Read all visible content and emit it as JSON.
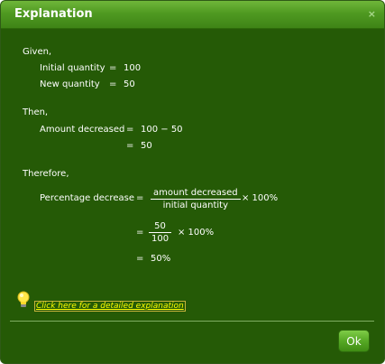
{
  "dialog": {
    "title": "Explanation",
    "close_symbol": "×",
    "ok_label": "Ok",
    "link_label": "Click here for a detailed explanation",
    "hint_icon": "lightbulb-icon"
  },
  "explanation": {
    "given_heading": "Given,",
    "initial_label": "Initial quantity",
    "initial_eq": "=",
    "initial_value": "100",
    "new_label": "New quantity",
    "new_eq": "=",
    "new_value": "50",
    "then_heading": "Then,",
    "amount_label": "Amount decreased",
    "amount_eq": "=",
    "amount_expr": "100 − 50",
    "amount_eq2": "=",
    "amount_result": "50",
    "therefore_heading": "Therefore,",
    "pct_label": "Percentage decrease",
    "pct_eq": "=",
    "frac1_num": "amount decreased",
    "frac1_den": "initial quantity",
    "times1": "× 100%",
    "pct_eq2": "=",
    "frac2_num": "50",
    "frac2_den": "100",
    "times2": "× 100%",
    "pct_eq3": "=",
    "pct_result": "50%"
  },
  "colors": {
    "background": "#255a06",
    "title_bar": "#4f9a21",
    "link": "#ffff00"
  }
}
